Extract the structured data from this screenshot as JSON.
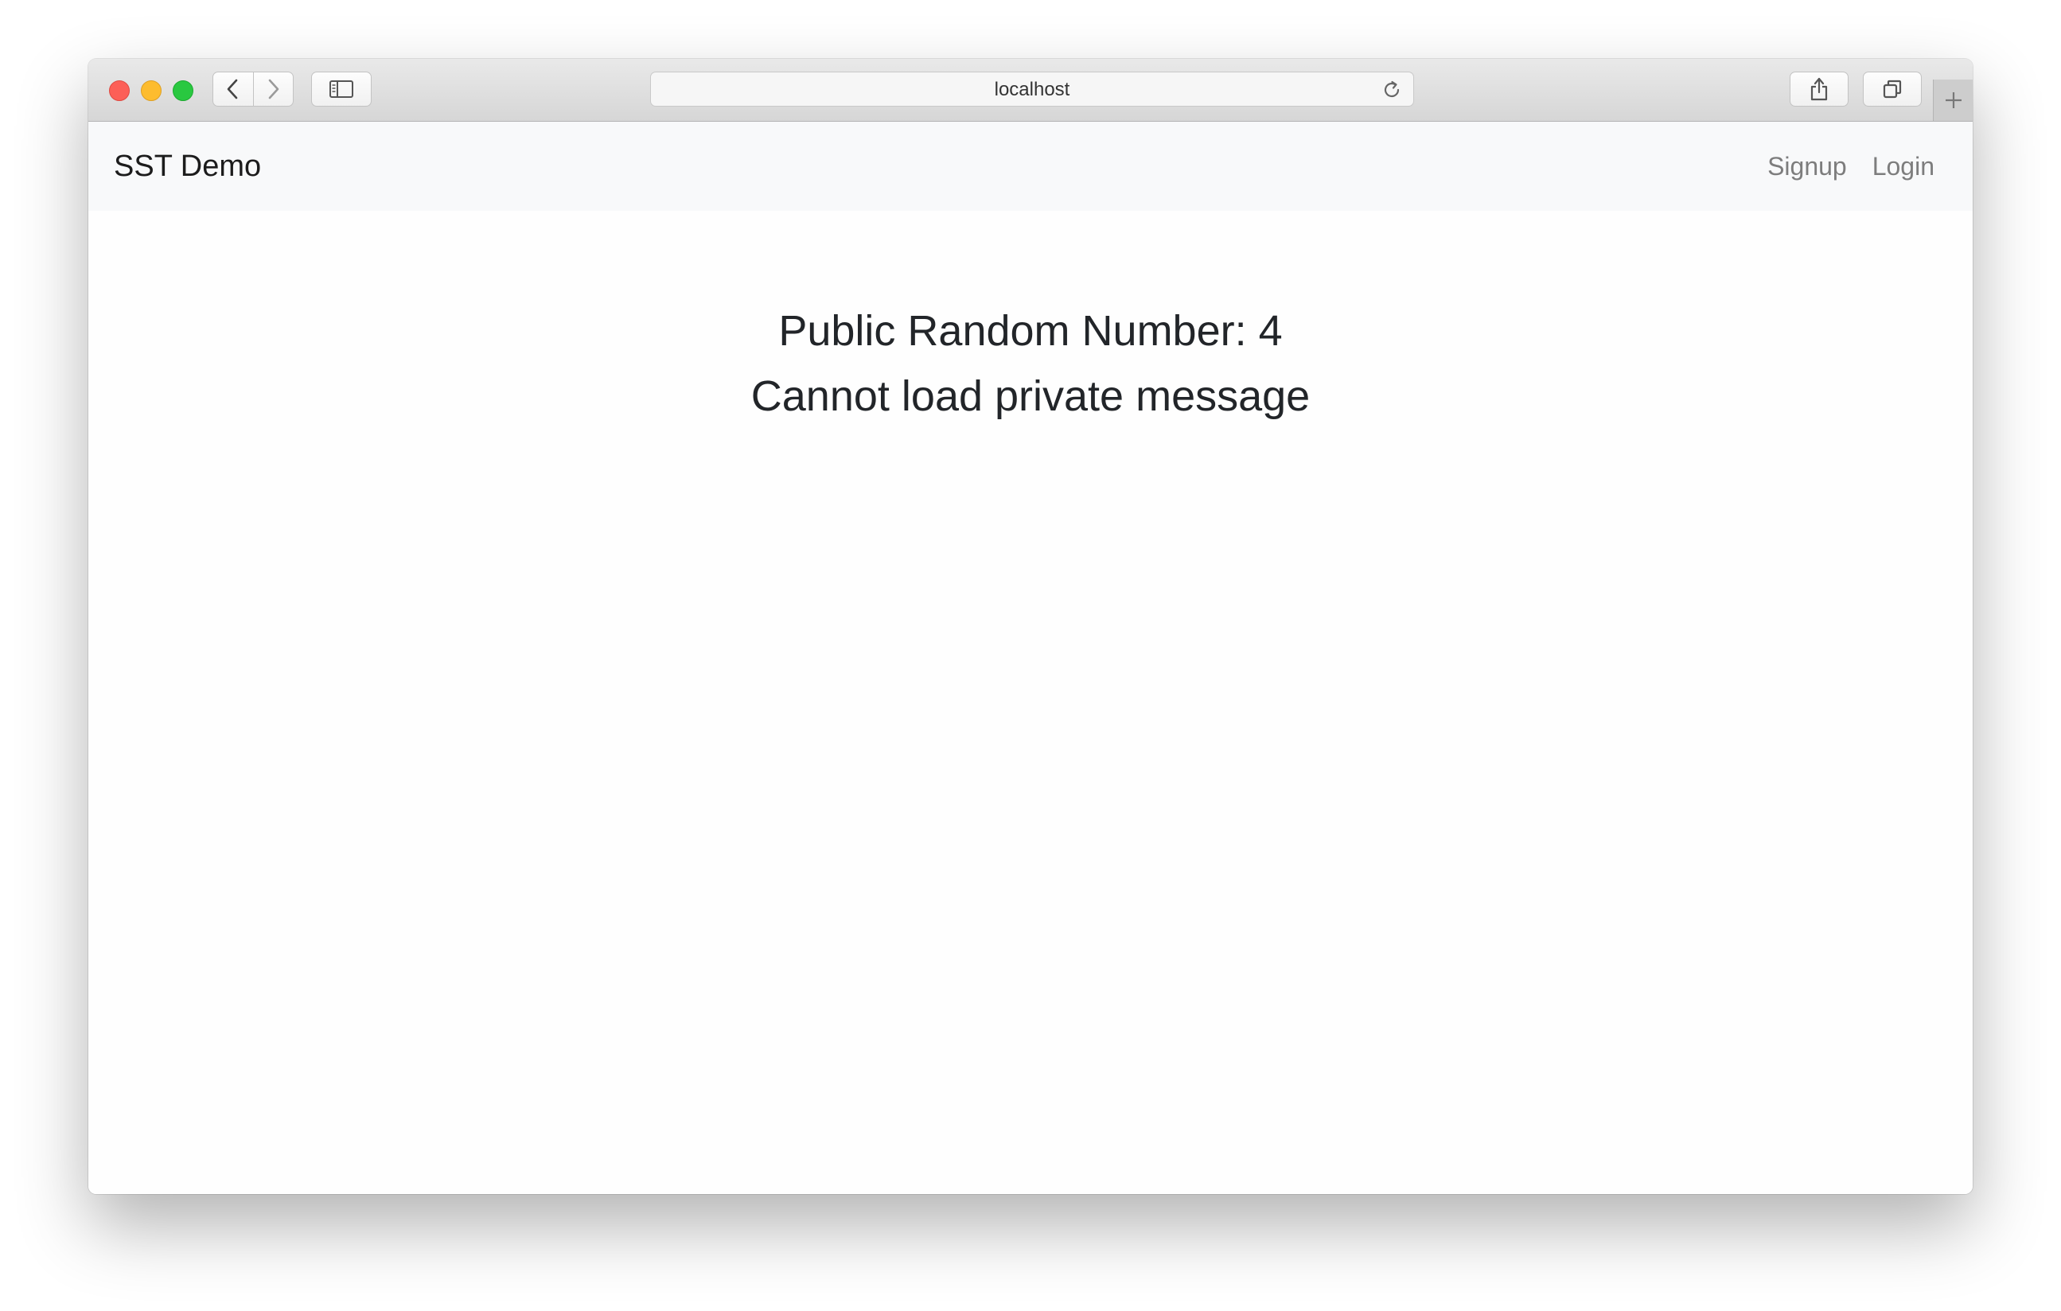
{
  "browser": {
    "url": "localhost",
    "icons": {
      "back": "chevron-left-icon",
      "forward": "chevron-right-icon",
      "sidebar": "sidebar-icon",
      "reload": "reload-icon",
      "share": "share-icon",
      "tabs": "tabs-icon",
      "new_tab": "plus-icon"
    }
  },
  "navbar": {
    "brand": "SST Demo",
    "links": {
      "signup": "Signup",
      "login": "Login"
    }
  },
  "main": {
    "public_number_label": "Public Random Number: 4",
    "private_message": "Cannot load private message"
  },
  "colors": {
    "close": "#fc5f57",
    "minimize": "#fdbc2e",
    "maximize": "#29c840",
    "navbar_bg": "#f8f9fa",
    "link_color": "#7d7d7d",
    "text_color": "#222529"
  }
}
